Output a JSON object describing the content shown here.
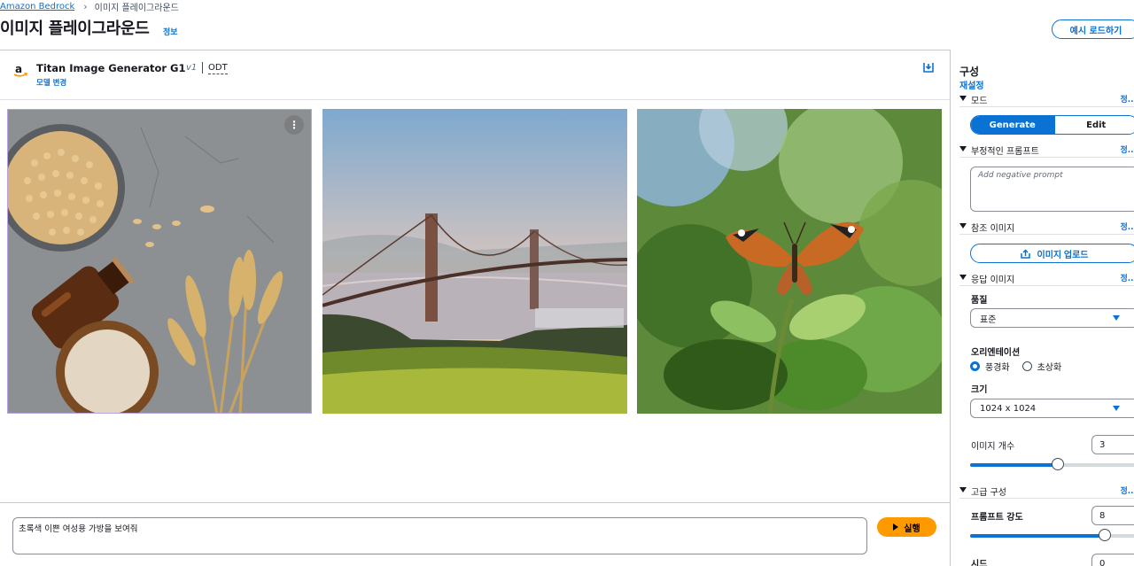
{
  "breadcrumb": {
    "root": "Amazon Bedrock",
    "current": "이미지 플레이그라운드"
  },
  "page": {
    "title": "이미지 플레이그라운드",
    "info": "정보",
    "load_example": "예시 로드하기"
  },
  "model": {
    "name": "Titan Image Generator G1",
    "version": "v1",
    "throughput": "ODT",
    "change": "모델 변경"
  },
  "tile_menu_glyph": "⋮",
  "prompt": {
    "value": "초록색 이쁜 여성용 가방을 보여줘",
    "run_label": "실행"
  },
  "config": {
    "title": "구성",
    "reset": "재설정",
    "info": "정...",
    "mode_section": "모드",
    "mode_generate": "Generate",
    "mode_edit": "Edit",
    "negative_section": "부정적인 프롬프트",
    "negative_placeholder": "Add negative prompt",
    "reference_section": "참조 이미지",
    "upload_label": "이미지 업로드",
    "response_section": "응답 이미지",
    "quality_label": "품질",
    "quality_value": "표준",
    "orientation_label": "오리엔테이션",
    "orientation_landscape": "풍경화",
    "orientation_portrait": "초상화",
    "size_label": "크기",
    "size_value": "1024 x 1024",
    "count_label": "이미지 개수",
    "count_value": "3",
    "count_fraction": 0.52,
    "advanced_section": "고급 구성",
    "prompt_strength_label": "프롬프트 강도",
    "prompt_strength_value": "8",
    "prompt_strength_fraction": 0.8,
    "seed_label": "시드",
    "seed_value": "0"
  },
  "colors": {
    "accent": "#0972d3",
    "run": "#ff9900",
    "text": "#16191f",
    "selected_tile_border": "#b8a3e3"
  }
}
